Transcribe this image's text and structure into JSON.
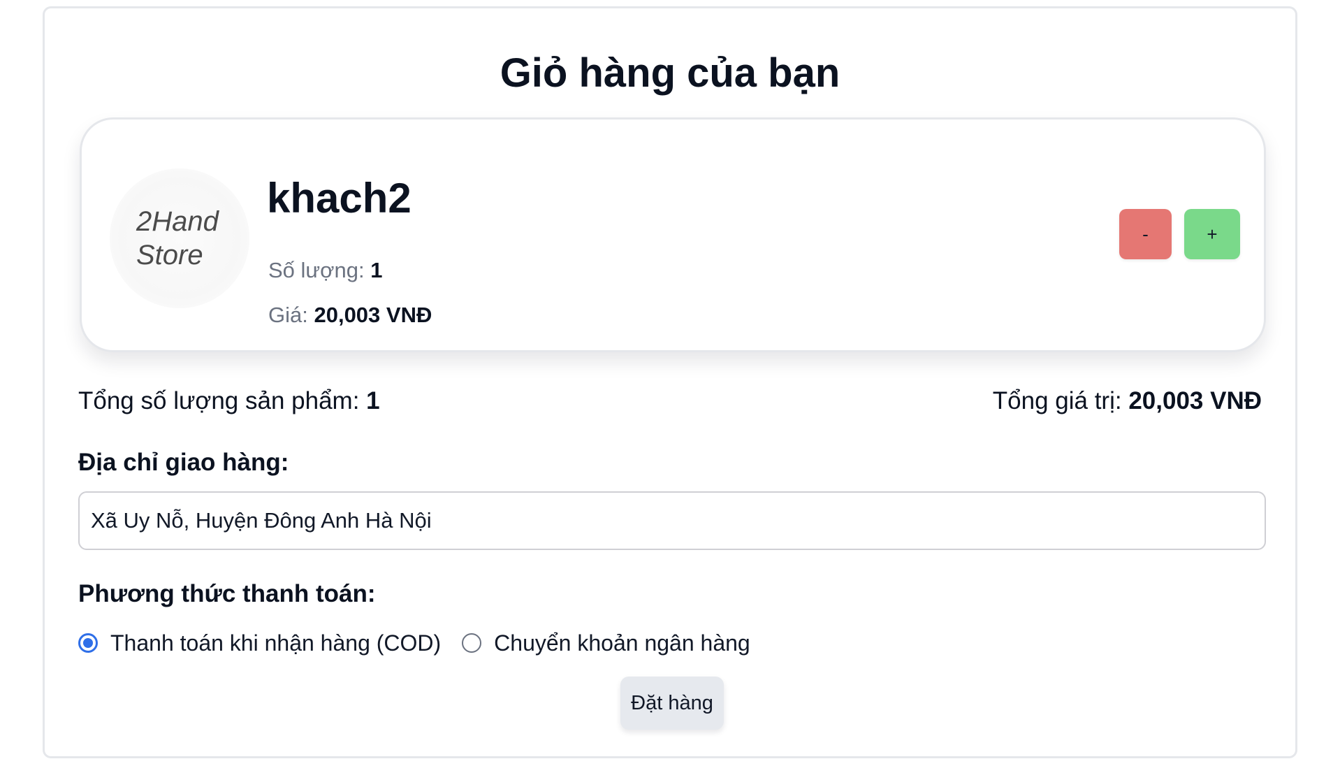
{
  "page": {
    "title": "Giỏ hàng của bạn"
  },
  "cart": {
    "items": [
      {
        "thumbnail_text": "2Hand\nStore",
        "name": "khach2",
        "quantity_label": "Số lượng: ",
        "quantity": "1",
        "price_label": "Giá: ",
        "price": "20,003 VNĐ",
        "decrease_label": "-",
        "increase_label": "+"
      }
    ]
  },
  "summary": {
    "total_qty_label": "Tổng số lượng sản phẩm: ",
    "total_qty": "1",
    "total_value_label": "Tổng giá trị: ",
    "total_value": "20,003 VNĐ"
  },
  "shipping": {
    "label": "Địa chỉ giao hàng:",
    "address": "Xã Uy Nỗ, Huyện Đông Anh Hà Nội"
  },
  "payment": {
    "label": "Phương thức thanh toán:",
    "options": [
      {
        "label": "Thanh toán khi nhận hàng (COD)",
        "selected": true
      },
      {
        "label": "Chuyển khoản ngân hàng",
        "selected": false
      }
    ]
  },
  "actions": {
    "submit_label": "Đặt hàng"
  },
  "colors": {
    "decrease_button": "#e57773",
    "increase_button": "#7ad98a",
    "radio_accent": "#2f6fe8",
    "submit_button": "#e6e9ee"
  }
}
